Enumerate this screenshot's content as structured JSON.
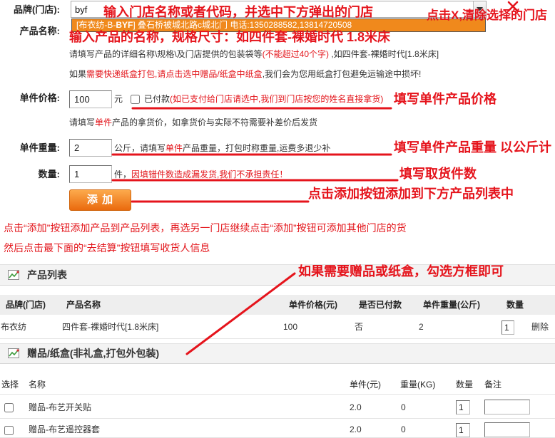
{
  "colors": {
    "annot": "#e5141c",
    "red": "#e3151b",
    "orange": "#f0891c",
    "button_top": "#fcaa4c",
    "button_bottom": "#ea6a0e"
  },
  "icons": {
    "combo_arrow": "chevron-down-icon",
    "clear": "close-icon",
    "section": "chart-icon"
  },
  "store": {
    "label": "品牌(门店):",
    "value": "byf",
    "suggestion": {
      "prefix": "[布衣纺-B-",
      "code": "BYF",
      "rest": "] 叠石桥被城北路c城北门 电话:1350288582,13814720508"
    }
  },
  "product_name": {
    "label": "产品名称:",
    "hint": {
      "before": "请填写产品的详细名称\\规格\\及门店提供的包装袋等",
      "limit": "(不能超过40个字)",
      "after": " ,如四件套-裸婚时代[1.8米床]"
    },
    "box_hint": {
      "before": "如果",
      "emphasis": "需要快递纸盒打包,请点击选中赠品/纸盒中纸盒",
      "after": ",我们会为您用纸盒打包避免运输途中损坏!"
    }
  },
  "price": {
    "label": "单件价格:",
    "value": "100",
    "unit": "元",
    "paid_label": "已付款",
    "paid_checked": false,
    "paid_note": "(如已支付给门店请选中,我们到门店按您的姓名直接拿货)",
    "hint": {
      "before": "请填写",
      "emphasis": "单件",
      "after": "产品的拿货价，如拿货价与实际不符需要补差价后发货"
    }
  },
  "weight": {
    "label": "单件重量:",
    "value": "2",
    "note": {
      "before": "公斤，请填写",
      "emphasis": "单件",
      "after": "产品重量，打包时称重量,运费多退少补"
    }
  },
  "quantity": {
    "label": "数量:",
    "value": "1",
    "note": {
      "before": "件，",
      "emphasis": "因填错件数造成漏发货,我们不承担责任！"
    }
  },
  "add_button": {
    "label": "添 加"
  },
  "instructions": [
    "点击“添加”按钮添加产品到产品列表，再选另一门店继续点击“添加”按钮可添加其他门店的货",
    "然后点击最下面的“去结算”按钮填写收货人信息"
  ],
  "annotations": {
    "store": "输入门店名称或者代码，并选中下方弹出的门店",
    "clear": "点击X,清除选择的门店",
    "product_name": "输入产品的名称，规格尺寸：如四件套-裸婚时代 1.8米床",
    "price": "填写单件产品价格",
    "weight": "填写单件产品重量 以公斤计",
    "quantity": "填写取货件数",
    "add": "点击添加按钮添加到下方产品列表中",
    "gift": "如果需要赠品或纸盒，勾选方框即可"
  },
  "product_list": {
    "title": "产品列表",
    "columns": [
      "品牌(门店)",
      "产品名称",
      "单件价格(元)",
      "是否已付款",
      "单件重量(公斤)",
      "数量"
    ],
    "rows": [
      {
        "brand": "布衣纺",
        "name": "四件套-裸婚时代[1.8米床]",
        "price": "100",
        "paid": "否",
        "weight": "2",
        "quantity": "1",
        "action": "删除"
      }
    ]
  },
  "gifts": {
    "title": "赠品/纸盒(非礼盒,打包外包装)",
    "columns": [
      "选择",
      "名称",
      "单件(元)",
      "重量(KG)",
      "数量",
      "备注"
    ],
    "rows": [
      {
        "selected": false,
        "name": "赠品-布艺开关贴",
        "price": "2.0",
        "weight": "0",
        "quantity": "1"
      },
      {
        "selected": false,
        "name": "赠品-布艺遥控器套",
        "price": "2.0",
        "weight": "0",
        "quantity": "1"
      }
    ]
  }
}
